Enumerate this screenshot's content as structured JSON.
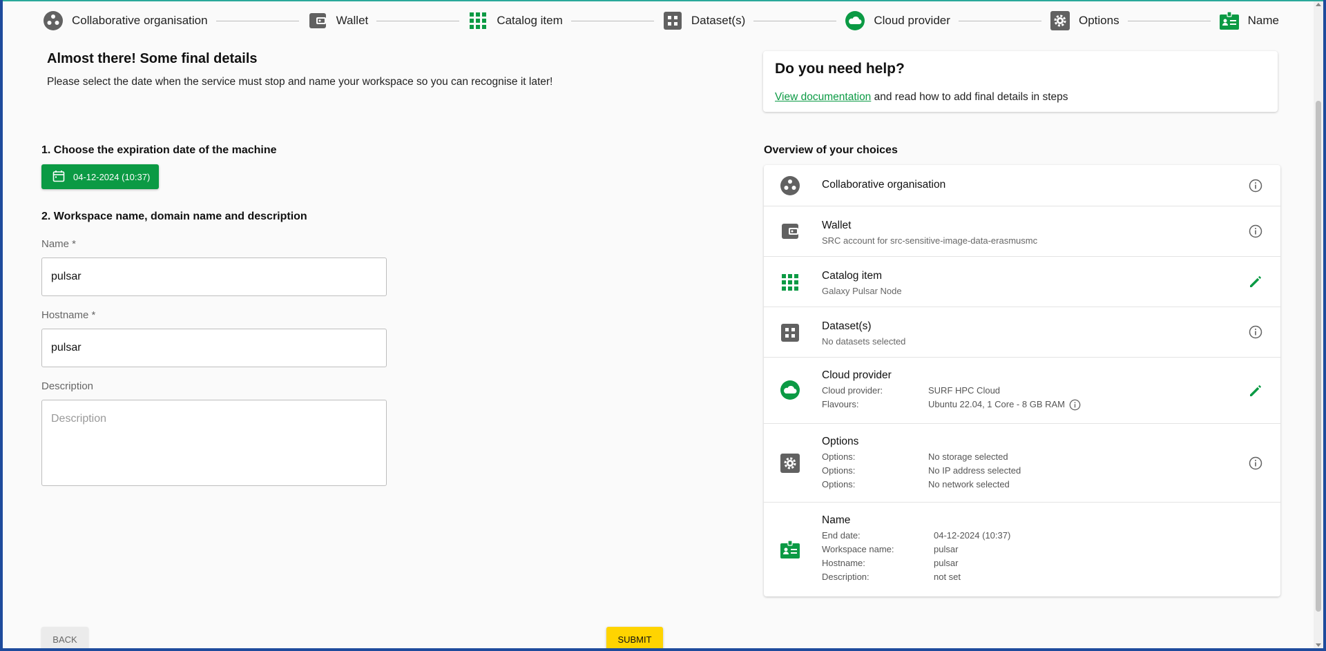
{
  "stepper": {
    "steps": [
      {
        "label": "Collaborative organisation",
        "icon": "group-icon",
        "active": false
      },
      {
        "label": "Wallet",
        "icon": "wallet-icon",
        "active": false
      },
      {
        "label": "Catalog item",
        "icon": "apps-grid-icon",
        "active": true
      },
      {
        "label": "Dataset(s)",
        "icon": "dataset-grid-icon",
        "active": false
      },
      {
        "label": "Cloud provider",
        "icon": "cloud-icon",
        "active": true
      },
      {
        "label": "Options",
        "icon": "gear-icon",
        "active": false
      },
      {
        "label": "Name",
        "icon": "badge-icon",
        "active": true
      }
    ]
  },
  "page": {
    "title": "Almost there! Some final details",
    "subtitle": "Please select the date when the service must stop and name your workspace so you can recognise it later!"
  },
  "form": {
    "section1": "1. Choose the expiration date of the machine",
    "date_value": "04-12-2024 (10:37)",
    "section2": "2. Workspace name, domain name and description",
    "name_label": "Name *",
    "name_value": "pulsar",
    "hostname_label": "Hostname *",
    "hostname_value": "pulsar",
    "description_label": "Description",
    "description_placeholder": "Description"
  },
  "help": {
    "title": "Do you need help?",
    "link_text": "View documentation",
    "text": " and read how to add final details in steps"
  },
  "overview": {
    "title": "Overview of your choices",
    "collab": {
      "name": "Collaborative organisation"
    },
    "wallet": {
      "name": "Wallet",
      "sub": "SRC account for src-sensitive-image-data-erasmusmc"
    },
    "catalog": {
      "name": "Catalog item",
      "sub": "Galaxy Pulsar Node"
    },
    "datasets": {
      "name": "Dataset(s)",
      "sub": "No datasets selected"
    },
    "cloud": {
      "name": "Cloud provider",
      "provider_key": "Cloud provider:",
      "provider_value": "SURF HPC Cloud",
      "flavours_key": "Flavours:",
      "flavours_value": "Ubuntu 22.04, 1 Core - 8 GB RAM"
    },
    "options": {
      "name": "Options",
      "rows": [
        {
          "k": "Options:",
          "v": "No storage selected"
        },
        {
          "k": "Options:",
          "v": "No IP address selected"
        },
        {
          "k": "Options:",
          "v": "No network selected"
        }
      ]
    },
    "name_section": {
      "name": "Name",
      "rows": [
        {
          "k": "End date:",
          "v": "04-12-2024 (10:37)"
        },
        {
          "k": "Workspace name:",
          "v": "pulsar"
        },
        {
          "k": "Hostname:",
          "v": "pulsar"
        },
        {
          "k": "Description:",
          "v": "not set"
        }
      ]
    }
  },
  "buttons": {
    "back": "Back",
    "submit": "Submit"
  },
  "colors": {
    "accent": "#0b9a44",
    "icon_grey": "#616161",
    "submit": "#ffd400"
  }
}
